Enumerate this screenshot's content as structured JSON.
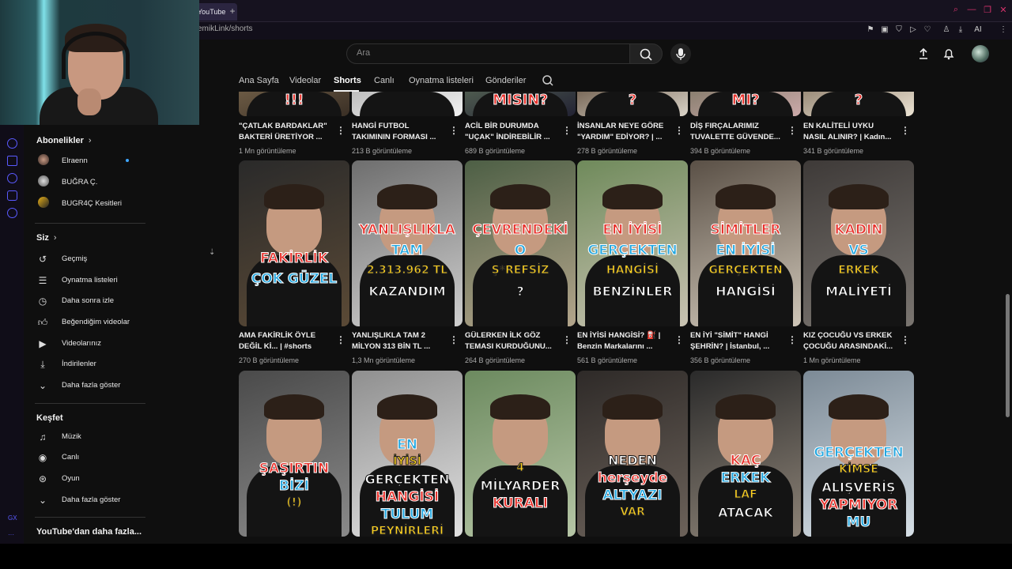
{
  "browser": {
    "tab_title": "YouTube",
    "url_fragment": "emikLink/shorts",
    "ai_label": "AI"
  },
  "guide": {
    "subscriptions_title": "Abonelikler",
    "subscriptions": [
      {
        "label": "Elraenn",
        "live": true
      },
      {
        "label": "BUĞRA Ç."
      },
      {
        "label": "BUGR4Ç Kesitleri"
      }
    ],
    "you_title": "Siz",
    "you_items": [
      {
        "label": "Geçmiş",
        "icon": "history-icon"
      },
      {
        "label": "Oynatma listeleri",
        "icon": "playlist-icon"
      },
      {
        "label": "Daha sonra izle",
        "icon": "clock-icon"
      },
      {
        "label": "Beğendiğim videolar",
        "icon": "thumb-up-icon"
      },
      {
        "label": "Videolarınız",
        "icon": "your-videos-icon"
      },
      {
        "label": "İndirilenler",
        "icon": "download-icon"
      },
      {
        "label": "Daha fazla göster",
        "icon": "chevron-down-icon"
      }
    ],
    "explore_title": "Keşfet",
    "explore_items": [
      {
        "label": "Müzik",
        "icon": "music-icon"
      },
      {
        "label": "Canlı",
        "icon": "live-icon"
      },
      {
        "label": "Oyun",
        "icon": "gaming-icon"
      },
      {
        "label": "Daha fazla göster",
        "icon": "chevron-down-icon"
      }
    ],
    "more_title": "YouTube'dan daha fazla..."
  },
  "masthead": {
    "search_placeholder": "Ara"
  },
  "channel_tabs": [
    "Ana Sayfa",
    "Videolar",
    "Shorts",
    "Canlı",
    "Oynatma listeleri",
    "Gönderiler"
  ],
  "active_tab": "Shorts",
  "row1": [
    {
      "line1": "\"ÇATLAK BARDAKLAR\"",
      "line2": "BAKTERİ ÜRETİYOR ...",
      "views": "1 Mn görüntüleme"
    },
    {
      "line1": "HANGİ FUTBOL",
      "line2": "TAKIMININ FORMASI ...",
      "views": "213 B görüntüleme"
    },
    {
      "line1": "ACİL BİR DURUMDA",
      "line2": "\"UÇAK\" İNDİREBİLİR ...",
      "views": "689 B görüntüleme"
    },
    {
      "line1": "İNSANLAR NEYE GÖRE",
      "line2": "\"YARDIM\" EDİYOR? | ...",
      "views": "278 B görüntüleme"
    },
    {
      "line1": "DİŞ FIRÇALARIMIZ",
      "line2": "TUVALETTE GÜVENDE...",
      "views": "394 B görüntüleme"
    },
    {
      "line1": "EN KALİTELİ UYKU",
      "line2": "NASIL ALINIR? | Kadın...",
      "views": "341 B görüntüleme"
    }
  ],
  "row1_captions": [
    "!!!",
    "",
    "MISIN?",
    "?",
    "MI?",
    "?"
  ],
  "row2": [
    {
      "line1": "AMA FAKİRLİK ÖYLE",
      "line2": "DEĞİL Kİ... | #shorts",
      "views": "270 B görüntüleme",
      "caps": [
        "FAKİRLİK",
        "ÇOK GÜZEL"
      ]
    },
    {
      "line1": "YANLIŞLIKLA TAM 2",
      "line2": "MİLYON 313 BİN TL ...",
      "views": "1,3 Mn görüntüleme",
      "caps": [
        "YANLIŞLIKLA",
        "TAM",
        "2.313.962 TL",
        "KAZANDIM"
      ]
    },
    {
      "line1": "GÜLERKEN İLK GÖZ",
      "line2": "TEMASI KURDUĞUNU...",
      "views": "264 B görüntüleme",
      "caps": [
        "ÇEVRENDEKİ",
        "O",
        "Ş*REFSİZ",
        "?"
      ]
    },
    {
      "line1": "EN İYİSİ HANGİSİ? ⛽ |",
      "line2": "Benzin Markalarını ...",
      "views": "561 B görüntüleme",
      "caps": [
        "EN İYİSİ",
        "GERÇEKTEN",
        "HANGİSİ",
        "BENZİNLER"
      ]
    },
    {
      "line1": "EN İYİ \"SİMİT\" HANGİ",
      "line2": "ŞEHRİN? | İstanbul, ...",
      "views": "356 B görüntüleme",
      "caps": [
        "SİMİTLER",
        "EN İYİSİ",
        "GERÇEKTEN",
        "HANGİSİ"
      ]
    },
    {
      "line1": "KIZ ÇOCUĞU VS ERKEK",
      "line2": "ÇOCUĞU ARASINDAKİ...",
      "views": "1 Mn görüntüleme",
      "caps": [
        "KADIN",
        "VS",
        "ERKEK",
        "MALİYETİ"
      ]
    }
  ],
  "row3": [
    {
      "caps": [
        "ŞAŞIRTIN",
        "BİZİ",
        "(!)"
      ]
    },
    {
      "caps": [
        "EN",
        "İYİSİ",
        "GERÇEKTEN",
        "HANGİSİ",
        "TULUM",
        "PEYNİRLERİ"
      ]
    },
    {
      "caps": [
        "4",
        "MİLYARDER",
        "KURALI"
      ]
    },
    {
      "caps": [
        "NEDEN",
        "herşeyde",
        "ALTYAZI",
        "VAR"
      ]
    },
    {
      "caps": [
        "KAÇ",
        "ERKEK",
        "LAF",
        "ATACAK"
      ]
    },
    {
      "caps": [
        "GERÇEKTEN",
        "KİMSE",
        "ALIŞVERİŞ",
        "YAPMIYOR",
        "MU"
      ]
    }
  ],
  "colors": {
    "accent": "#e8322c",
    "blue": "#23a7e0",
    "yellow": "#ffd21f"
  }
}
